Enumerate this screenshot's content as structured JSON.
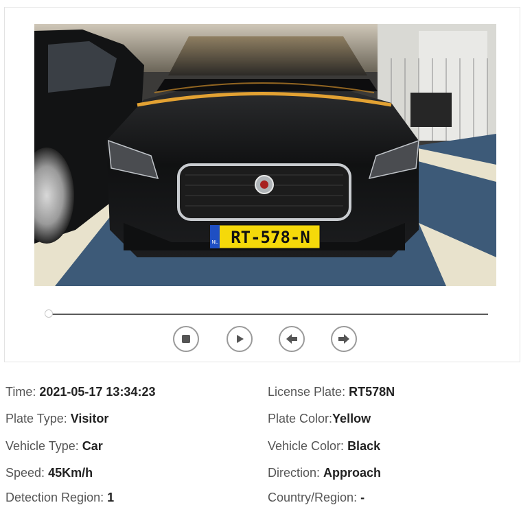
{
  "snapshot": {
    "plate_text": "RT-578-N",
    "plate_country_code": "NL",
    "colors": {
      "plate_yellow": "#f5d90a",
      "eu_band_blue": "#1f4fc3",
      "car_body": "#141516",
      "floor_blue": "#3d5a78",
      "floor_lines": "#e8e2cc"
    },
    "progress": 0
  },
  "controls": {
    "stop_icon": "stop-circle-icon",
    "play_icon": "play-circle-icon",
    "prev_icon": "arrow-left-circle-icon",
    "next_icon": "arrow-right-circle-icon"
  },
  "details": {
    "left": [
      {
        "label": "Time: ",
        "value": "2021-05-17 13:34:23"
      },
      {
        "label": "Plate Type: ",
        "value": "Visitor"
      },
      {
        "label": "Vehicle Type: ",
        "value": "Car"
      },
      {
        "label": "Speed: ",
        "value": "45Km/h"
      },
      {
        "label": "Detection Region: ",
        "value": "1"
      }
    ],
    "right": [
      {
        "label": "License Plate: ",
        "value": "RT578N"
      },
      {
        "label": "Plate Color:",
        "value": "Yellow"
      },
      {
        "label": "Vehicle Color: ",
        "value": "Black"
      },
      {
        "label": "Direction: ",
        "value": "Approach"
      },
      {
        "label": "Country/Region: ",
        "value": "-"
      }
    ]
  }
}
